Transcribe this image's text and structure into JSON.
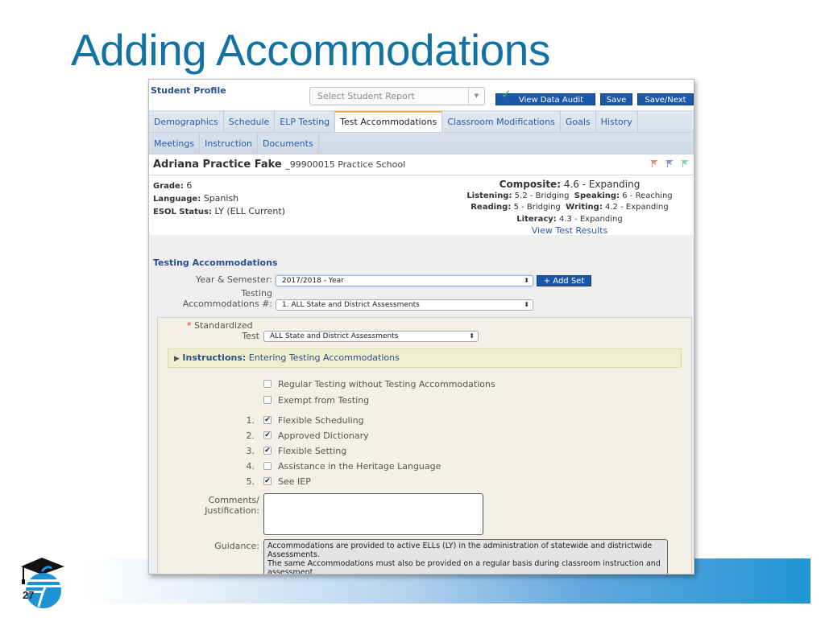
{
  "slide": {
    "title": "Adding Accommodations",
    "page_number": "27"
  },
  "app": {
    "title": "Student Profile",
    "report_select_placeholder": "Select Student Report",
    "buttons": {
      "view_data_audit": "View Data Audit",
      "save": "Save",
      "save_next": "Save/Next",
      "add_set": "+ Add Set"
    },
    "tabs_row1": [
      {
        "label": "Demographics",
        "active": false
      },
      {
        "label": "Schedule",
        "active": false
      },
      {
        "label": "ELP Testing",
        "active": false
      },
      {
        "label": "Test Accommodations",
        "active": true
      },
      {
        "label": "Classroom Modifications",
        "active": false
      },
      {
        "label": "Goals",
        "active": false
      },
      {
        "label": "History",
        "active": false
      }
    ],
    "tabs_row2": [
      {
        "label": "Meetings",
        "active": false
      },
      {
        "label": "Instruction",
        "active": false
      },
      {
        "label": "Documents",
        "active": false
      }
    ],
    "student": {
      "name": "Adriana Practice Fake",
      "id_school": "_99900015 Practice School",
      "grade_label": "Grade:",
      "grade": "6",
      "language_label": "Language:",
      "language": "Spanish",
      "esol_label": "ESOL Status:",
      "esol": "LY (ELL Current)",
      "flags": [
        {
          "name": "red-flag",
          "color": "#f08a7a"
        },
        {
          "name": "blue-flag",
          "color": "#7f92e6"
        },
        {
          "name": "green-flag",
          "color": "#7fd6a6"
        }
      ]
    },
    "scores": {
      "composite_label": "Composite:",
      "composite": "4.6 - Expanding",
      "listening_label": "Listening:",
      "listening": "5.2 - Bridging",
      "speaking_label": "Speaking:",
      "speaking": "6 - Reaching",
      "reading_label": "Reading:",
      "reading": "5 - Bridging",
      "writing_label": "Writing:",
      "writing": "4.2 - Expanding",
      "literacy_label": "Literacy:",
      "literacy": "4.3 - Expanding",
      "view_results_link": "View Test Results"
    },
    "testing": {
      "section_title": "Testing Accommodations",
      "year_label": "Year & Semester:",
      "year_value": "2017/2018 - Year",
      "accom_label_1": "Testing",
      "accom_label_2": "Accommodations #:",
      "accom_value": "1. ALL State and District Assessments",
      "required_mark": "*",
      "std_test_label_1": "Standardized",
      "std_test_label_2": "Test",
      "std_test_value": "ALL State and District Assessments",
      "instructions_bold": "Instructions:",
      "instructions_text": "Entering Testing Accommodations",
      "options": [
        {
          "num": "",
          "label": "Regular Testing without Testing Accommodations",
          "checked": false
        },
        {
          "num": "",
          "label": "Exempt from Testing",
          "checked": false
        },
        {
          "num": "1.",
          "label": "Flexible Scheduling",
          "checked": true
        },
        {
          "num": "2.",
          "label": "Approved Dictionary",
          "checked": true
        },
        {
          "num": "3.",
          "label": "Flexible Setting",
          "checked": true
        },
        {
          "num": "4.",
          "label": "Assistance in the Heritage Language",
          "checked": false
        },
        {
          "num": "5.",
          "label": "See IEP",
          "checked": true
        }
      ],
      "comments_label_1": "Comments/",
      "comments_label_2": "Justification:",
      "comments_value": "",
      "guidance_label": "Guidance:",
      "guidance_text": "Accommodations are provided to active ELLs (LY) in the administration of statewide and districtwide Assessments.\nThe same Accommodations must also be provided on a regular basis during classroom instruction and assessment."
    }
  }
}
